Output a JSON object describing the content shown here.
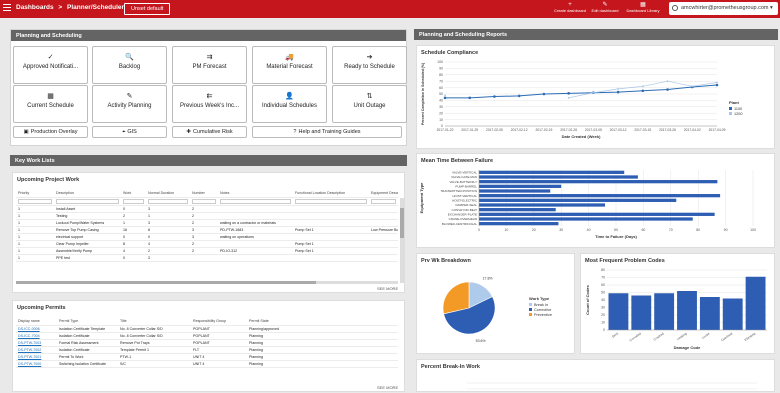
{
  "topbar": {
    "crumb_home": "Dashboards",
    "crumb_sep": ">",
    "crumb_page": "Planner/Scheduler",
    "unset_label": "Unset default",
    "tools": [
      {
        "icon": "+",
        "label": "Create dashboard"
      },
      {
        "icon": "✎",
        "label": "Edit dashboard"
      },
      {
        "icon": "▦",
        "label": "Dashboard Library"
      }
    ],
    "user_email": "amcwhirter@prometheusgroup.com",
    "user_caret": "▾"
  },
  "planning": {
    "header": "Planning and Scheduling",
    "buttons_row1": [
      {
        "icon": "✓",
        "label": "Approved Notificati..."
      },
      {
        "icon": "🔍",
        "label": "Backlog"
      },
      {
        "icon": "⇉",
        "label": "PM Forecast"
      },
      {
        "icon": "🚚",
        "label": "Material Forecast"
      },
      {
        "icon": "➔",
        "label": "Ready to Schedule"
      }
    ],
    "buttons_row2": [
      {
        "icon": "▦",
        "label": "Current Schedule"
      },
      {
        "icon": "✎",
        "label": "Activity Planning"
      },
      {
        "icon": "⇇",
        "label": "Previous Week's Inc..."
      },
      {
        "icon": "👤",
        "label": "Individual Schedules"
      },
      {
        "icon": "⇅",
        "label": "Unit Outage"
      }
    ],
    "buttons_row3": [
      {
        "icon": "▣",
        "label": "Production Overlay"
      },
      {
        "icon": "⌖",
        "label": "GIS"
      },
      {
        "icon": "✚",
        "label": "Cumulative Risk"
      },
      {
        "icon": "?",
        "label": "Help and Training Guides"
      }
    ]
  },
  "keywork": {
    "header": "Key Work Lists",
    "projects": {
      "title": "Upcoming Project Work",
      "columns": [
        "Priority",
        "Description",
        "Work",
        "Normal Duration",
        "Number",
        "Notes",
        "Functional Location Description",
        "Equipment Descripti"
      ],
      "rows": [
        [
          "1",
          "Install Asset",
          "0",
          "3",
          "2",
          "",
          "",
          ""
        ],
        [
          "1",
          "Testing",
          "2",
          "1",
          "2",
          "",
          "",
          ""
        ],
        [
          "1",
          "Lockout Pump/Water Systems",
          "1",
          "3",
          "2",
          "waiting on a contractor or materials",
          "",
          ""
        ],
        [
          "1",
          "Remove Top Pump Casing",
          "16",
          "8",
          "3",
          "PD-PTW-1683",
          "Pump Set 1",
          "Low Pressure Boos"
        ],
        [
          "1",
          "electrical support",
          "0",
          "0",
          "3",
          "waiting on operations",
          "",
          ""
        ],
        [
          "1",
          "Clear Pump Impeller",
          "8",
          "4",
          "2",
          "",
          "Pump Set 1",
          ""
        ],
        [
          "1",
          "Assemble/Verify Pump",
          "4",
          "2",
          "2",
          "PD-IO-312",
          "Pump Set 1",
          ""
        ],
        [
          "1",
          "PPE test",
          "0",
          "3",
          "",
          "",
          "",
          ""
        ]
      ],
      "see_more": "SEE MORE"
    },
    "permits": {
      "title": "Upcoming Permits",
      "columns": [
        "Display name",
        "Permit Type",
        "Title",
        "Responsibility Group",
        "Permit State"
      ],
      "rows": [
        [
          "DS-ICC-0006",
          "Isolation Certificate Template",
          "No. 8 Converter Collar S/D",
          "PGPLANT",
          "Planning/approved"
        ],
        [
          "DS-ICC-7004",
          "Isolation Certificate",
          "No. 8 Converter Collar S/D",
          "PGPLANT",
          "Planning"
        ],
        [
          "DS-PTW-7003",
          "Formal Risk Assessment",
          "Remove Pot Trays",
          "PGPLANT",
          "Planning"
        ],
        [
          "DS-PTW-7002",
          "Isolation Certificate",
          "Template Permit 1",
          "FLT",
          "Planning"
        ],
        [
          "DS-PTW-7001",
          "Permit To Work",
          "PTW-1",
          "UNIT 4",
          "Planning"
        ],
        [
          "DS-PTW-7000",
          "Switching Isolation Certificate",
          "S/C",
          "UNIT 4",
          "Planning"
        ]
      ],
      "see_more": "SEE MORE"
    }
  },
  "reports": {
    "header": "Planning and Scheduling Reports",
    "compliance": {
      "title": "Schedule Compliance",
      "xlabel": "Date Created (Week)",
      "ylabel": "Percent Completion in Scheduled (%)",
      "legend_title": "Plant",
      "series_colors": [
        "#2b6cb5",
        "#a9c6e8"
      ]
    },
    "mtbf": {
      "title": "Mean Time Between Failure",
      "xlabel": "Time to Failure (Days)",
      "ylabel": "Equipment Type",
      "bar_color": "#2d5eb3"
    },
    "breakdown": {
      "title": "Prv Wk Breakdown",
      "legend_title": "Work Type",
      "colors": [
        "#aecbeb",
        "#2d5eb3",
        "#f39a26"
      ]
    },
    "problems": {
      "title": "Most Frequent Problem Codes",
      "xlabel": "Damage Code",
      "ylabel": "Count of Codes",
      "bar_color": "#2d5eb3"
    },
    "breakin": {
      "title": "Percent Break-In Work"
    }
  },
  "chart_data": [
    {
      "type": "line",
      "title": "Schedule Compliance",
      "xlabel": "Date Created (Week)",
      "ylabel": "Percent Completion in Scheduled (%)",
      "x": [
        "2017-01-22",
        "2017-01-29",
        "2017-02-05",
        "2017-02-12",
        "2017-02-19",
        "2017-02-26",
        "2017-03-05",
        "2017-03-12",
        "2017-03-19",
        "2017-03-26",
        "2017-04-02",
        "2017-04-09"
      ],
      "ylim": [
        0,
        100
      ],
      "yticks": [
        0,
        10,
        20,
        30,
        40,
        50,
        60,
        70,
        80,
        90,
        100
      ],
      "legend_title": "Plant",
      "series": [
        {
          "name": "1100",
          "values": [
            44,
            44,
            46,
            47,
            50,
            51,
            52,
            53,
            55,
            57,
            61,
            64
          ]
        },
        {
          "name": "1200",
          "values": [
            48,
            null,
            null,
            null,
            null,
            44,
            52,
            58,
            62,
            70,
            62,
            68
          ]
        }
      ]
    },
    {
      "type": "bar",
      "orientation": "horizontal",
      "title": "Mean Time Between Failure",
      "xlabel": "Time to Failure (Days)",
      "ylabel": "Equipment Type",
      "xlim": [
        0,
        100
      ],
      "xticks": [
        0,
        10,
        20,
        30,
        40,
        50,
        60,
        70,
        80,
        90,
        100
      ],
      "categories": [
        "VALVE-VERTICAL",
        "VALVE-GATE-MAN",
        "VALVE-BUTTERFLY",
        "PUMP-BARREL",
        "TRANSMITTER-POSITION",
        "HOIST-VERTICAL",
        "HOIST-ELECTRIC",
        "DAMPER-SEAL",
        "CONVEYOR-BELT",
        "EXCHANGER-PLATE",
        "CRANE-OVERHEAD",
        "BLOWER-CENTRIFUGAL"
      ],
      "values": [
        53,
        58,
        87,
        30,
        26,
        88,
        72,
        46,
        28,
        86,
        78,
        29
      ]
    },
    {
      "type": "pie",
      "title": "Prv Wk Breakdown",
      "legend_title": "Work Type",
      "categories": [
        "Break In",
        "Corrective",
        "Preventive"
      ],
      "values": [
        17.8,
        53.6,
        28.6
      ],
      "labels": [
        "17.8%",
        "53.6%",
        ""
      ]
    },
    {
      "type": "bar",
      "title": "Most Frequent Problem Codes",
      "xlabel": "Damage Code",
      "ylabel": "Count of Codes",
      "ylim": [
        0,
        80
      ],
      "yticks": [
        0,
        10,
        20,
        30,
        40,
        50,
        60,
        70,
        80
      ],
      "categories": [
        "Bent",
        "Corroded",
        "Cracked",
        "Leaking",
        "Loose",
        "Overheat",
        "Vibrating"
      ],
      "values": [
        49,
        46,
        49,
        52,
        44,
        42,
        71
      ]
    }
  ]
}
